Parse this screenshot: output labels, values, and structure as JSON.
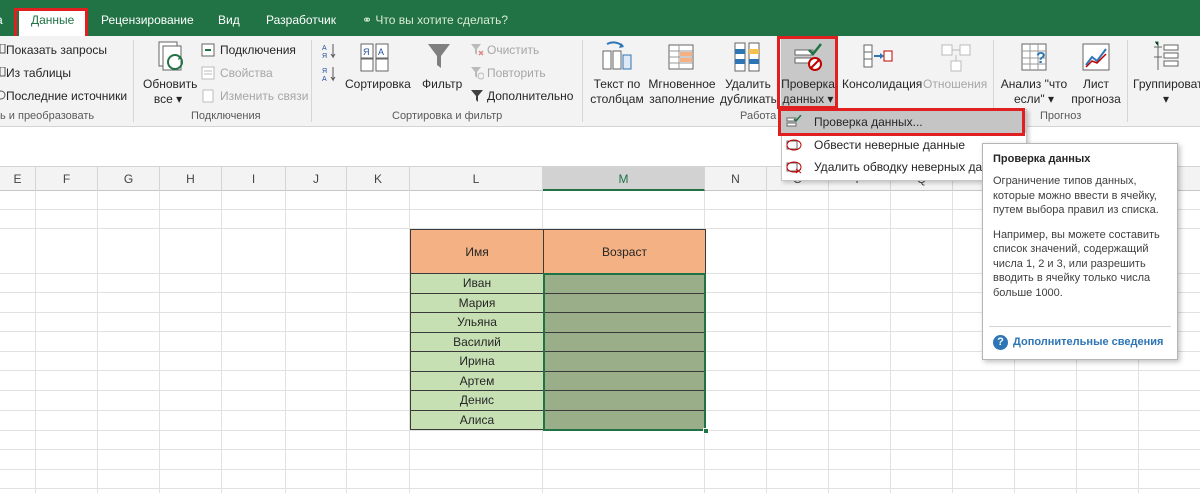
{
  "tabs": [
    {
      "label": "Данные",
      "active": true
    },
    {
      "label": "Рецензирование"
    },
    {
      "label": "Вид"
    },
    {
      "label": "Разработчик"
    }
  ],
  "tell_me": "Что вы хотите сделать?",
  "ribbon": {
    "get_transform": {
      "show_queries": "Показать запросы",
      "from_table": "Из таблицы",
      "recent_sources": "Последние источники",
      "group_label": "ь и преобразовать"
    },
    "connections": {
      "refresh_all_1": "Обновить",
      "refresh_all_2": "все",
      "connections": "Подключения",
      "properties": "Свойства",
      "edit_links": "Изменить связи",
      "group_label": "Подключения"
    },
    "sort_filter": {
      "sort": "Сортировка",
      "filter": "Фильтр",
      "clear": "Очистить",
      "reapply": "Повторить",
      "advanced": "Дополнительно",
      "group_label": "Сортировка и фильтр"
    },
    "data_tools": {
      "text_to_columns_1": "Текст по",
      "text_to_columns_2": "столбцам",
      "flash_fill_1": "Мгновенное",
      "flash_fill_2": "заполнение",
      "remove_dup_1": "Удалить",
      "remove_dup_2": "дубликаты",
      "validation_1": "Проверка",
      "validation_2": "данных",
      "consolidate": "Консолидация",
      "relationships": "Отношения",
      "group_label": "Работа"
    },
    "forecast": {
      "what_if_1": "Анализ \"что",
      "what_if_2": "если\"",
      "forecast_sheet_1": "Лист",
      "forecast_sheet_2": "прогноза",
      "group_label": "Прогноз"
    },
    "outline": {
      "group": "Группировать"
    }
  },
  "dropdown": {
    "items": [
      {
        "label": "Проверка данных..."
      },
      {
        "label": "Обвести неверные данные"
      },
      {
        "label": "Удалить обводку неверных данных"
      }
    ]
  },
  "tooltip": {
    "title": "Проверка данных",
    "p1": "Ограничение типов данных, которые можно ввести в ячейку, путем выбора правил из списка.",
    "p2": "Например, вы можете составить список значений, содержащий числа 1, 2 и 3, или разрешить вводить в ячейку только числа больше 1000.",
    "link": "Дополнительные сведения"
  },
  "columns": [
    "E",
    "F",
    "G",
    "H",
    "I",
    "J",
    "K",
    "L",
    "M",
    "N",
    "O",
    "P",
    "Q"
  ],
  "table": {
    "headers": [
      "Имя",
      "Возраст"
    ],
    "rows": [
      "Иван",
      "Мария",
      "Ульяна",
      "Василий",
      "Ирина",
      "Артем",
      "Денис",
      "Алиса"
    ]
  },
  "colors": {
    "excel_green": "#217346",
    "header_fill": "#f4b183",
    "name_fill": "#c6e0b4",
    "age_fill": "#9aae8a",
    "highlight_red": "#e02020"
  }
}
